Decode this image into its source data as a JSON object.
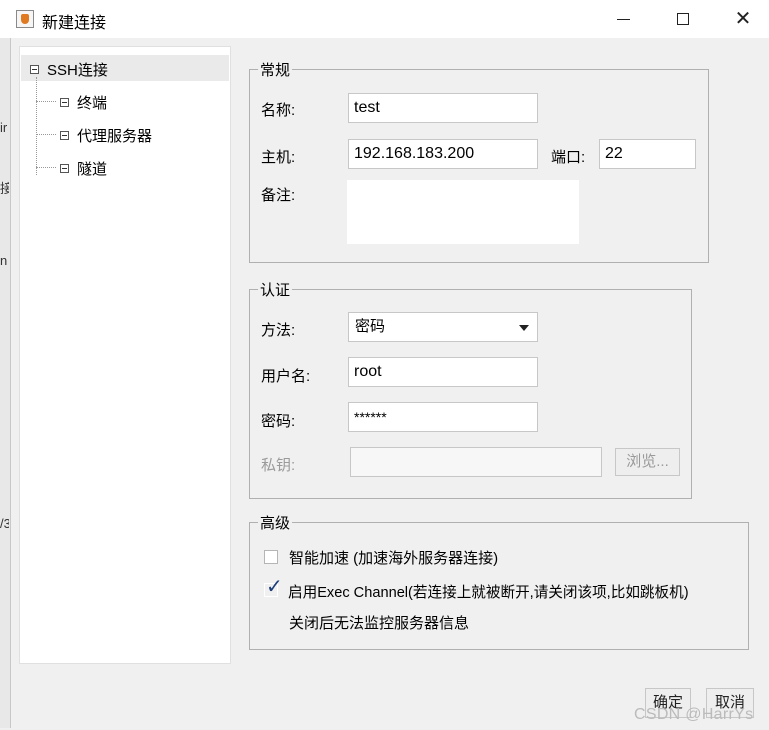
{
  "window": {
    "title": "新建连接",
    "controls": {
      "minimize": "minimize-icon",
      "maximize": "maximize-icon",
      "close": "close-icon"
    }
  },
  "background_fragments": [
    "ir",
    "接",
    "n",
    "/3"
  ],
  "tree": {
    "root": "SSH连接",
    "children": [
      "终端",
      "代理服务器",
      "隧道"
    ]
  },
  "general": {
    "legend": "常规",
    "name_label": "名称:",
    "name_value": "test",
    "host_label": "主机:",
    "host_value": "192.168.183.200",
    "port_label": "端口:",
    "port_value": "22",
    "note_label": "备注:",
    "note_value": ""
  },
  "auth": {
    "legend": "认证",
    "method_label": "方法:",
    "method_value": "密码",
    "user_label": "用户名:",
    "user_value": "root",
    "password_label": "密码:",
    "password_value": "******",
    "key_label": "私钥:",
    "key_value": "",
    "browse_label": "浏览..."
  },
  "advanced": {
    "legend": "高级",
    "accelerate_label": "智能加速 (加速海外服务器连接)",
    "accelerate_checked": false,
    "exec_label": "启用Exec Channel(若连接上就被断开,请关闭该项,比如跳板机)",
    "exec_checked": true,
    "exec_note": "关闭后无法监控服务器信息"
  },
  "footer": {
    "ok_label": "确定",
    "cancel_label": "取消"
  },
  "watermark": "CSDN @HarrYs"
}
